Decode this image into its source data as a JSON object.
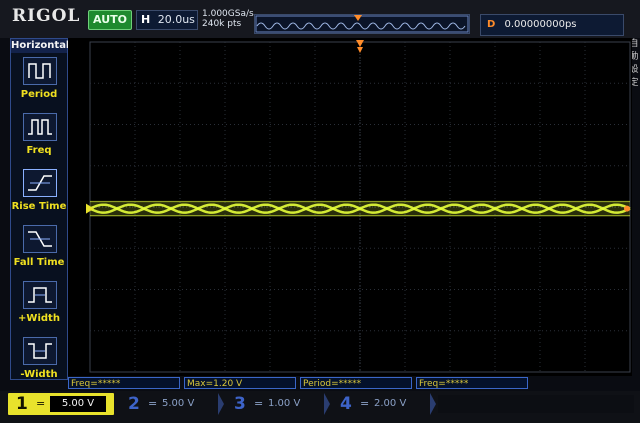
{
  "brand": "RIGOL",
  "status": "AUTO",
  "timebase": {
    "label": "H",
    "value": "20.0us"
  },
  "sample": {
    "rate": "1.000GSa/s",
    "points": "240k pts"
  },
  "trigger": {
    "label": "D",
    "delay": "0.00000000ps"
  },
  "menu": {
    "title": "Horizontal",
    "items": [
      {
        "label": "Period",
        "icon": "period-icon"
      },
      {
        "label": "Freq",
        "icon": "frequency-icon"
      },
      {
        "label": "Rise Time",
        "icon": "rise-time-icon"
      },
      {
        "label": "Fall Time",
        "icon": "fall-time-icon"
      },
      {
        "label": "+Width",
        "icon": "positive-width-icon"
      },
      {
        "label": "-Width",
        "icon": "negative-width-icon"
      }
    ]
  },
  "right_strip": [
    "自",
    "動",
    "設",
    "定"
  ],
  "measurements": [
    "Freq=*****",
    "Max=1.20 V",
    "Period=*****",
    "Freq=*****"
  ],
  "channels": [
    {
      "num": "1",
      "eq": "=",
      "value": "5.00 V"
    },
    {
      "num": "2",
      "eq": "=",
      "value": "5.00 V"
    },
    {
      "num": "3",
      "eq": "=",
      "value": "1.00 V"
    },
    {
      "num": "4",
      "eq": "=",
      "value": "2.00 V"
    }
  ],
  "colors": {
    "ch1": "#e8e22c",
    "trace": "#e6ff3a",
    "trigger_marker": "#ff8c2a",
    "grid": "#2a2f38"
  }
}
